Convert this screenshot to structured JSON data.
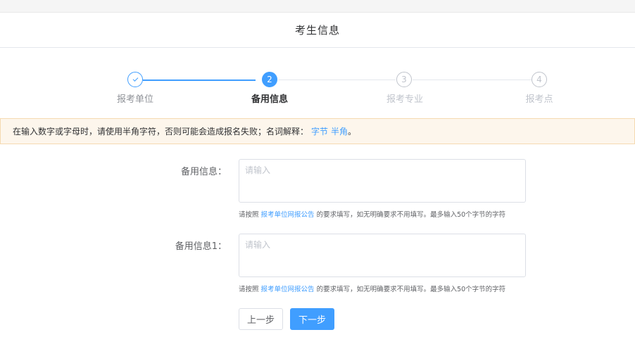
{
  "header": {
    "title": "考生信息"
  },
  "steps": [
    {
      "index": "1",
      "label": "报考单位",
      "status": "done"
    },
    {
      "index": "2",
      "label": "备用信息",
      "status": "current"
    },
    {
      "index": "3",
      "label": "报考专业",
      "status": "pending"
    },
    {
      "index": "4",
      "label": "报考点",
      "status": "pending"
    }
  ],
  "alert": {
    "text": "在输入数字或字母时，请使用半角字符，否则可能会造成报名失败；名词解释：",
    "link1": "字节",
    "link2": "半角",
    "end": "。"
  },
  "fields": [
    {
      "label": "备用信息：",
      "placeholder": "请输入",
      "value": "",
      "hint_prefix": "请按照",
      "hint_link": "报考单位网报公告",
      "hint_suffix": "的要求填写，如无明确要求不用填写。最多输入50个字节的字符"
    },
    {
      "label": "备用信息1：",
      "placeholder": "请输入",
      "value": "",
      "hint_prefix": "请按照",
      "hint_link": "报考单位网报公告",
      "hint_suffix": "的要求填写，如无明确要求不用填写。最多输入50个字节的字符"
    }
  ],
  "buttons": {
    "prev": "上一步",
    "next": "下一步"
  },
  "colors": {
    "primary": "#409eff",
    "alert_bg": "#fdf6ec",
    "alert_border": "#f5dab1"
  }
}
